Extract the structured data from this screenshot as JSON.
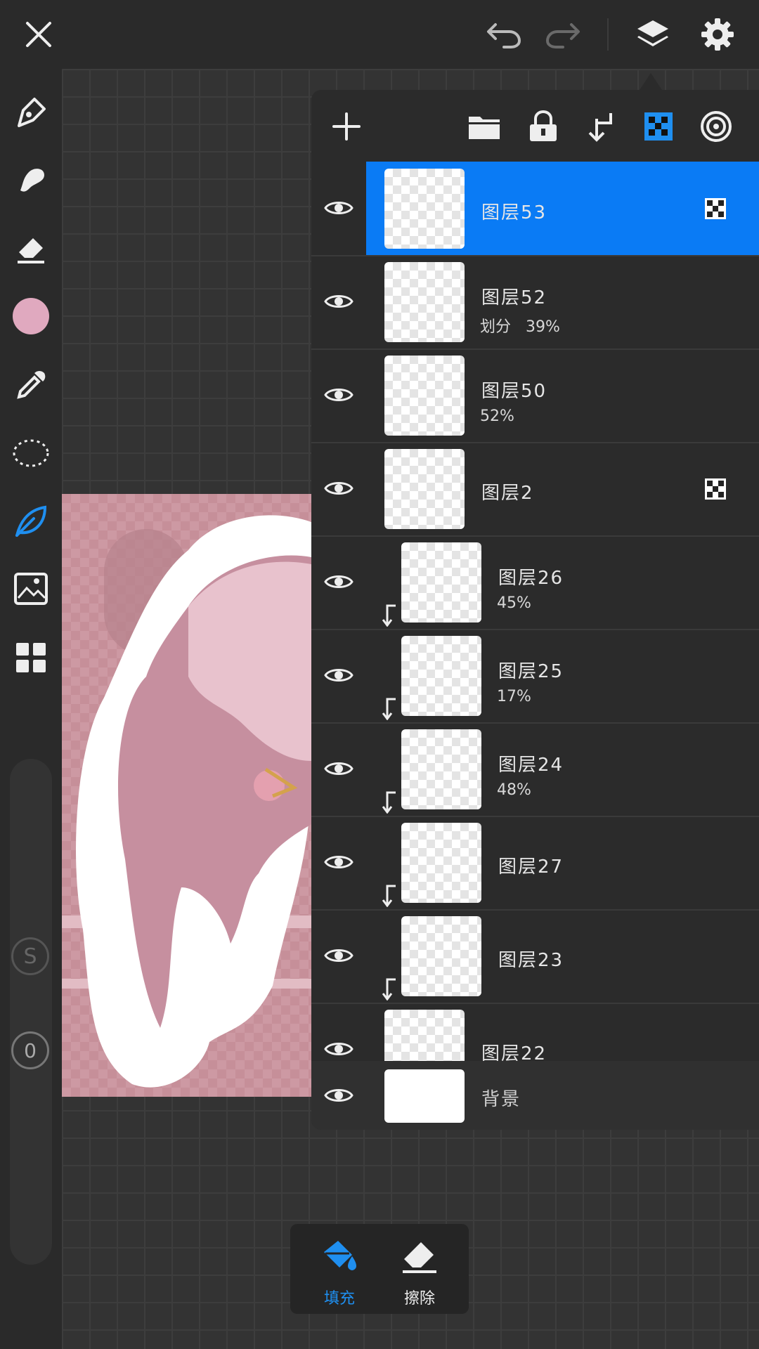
{
  "topbar": {
    "icons": [
      "close-icon",
      "undo-icon",
      "redo-icon",
      "layers-icon",
      "settings-icon"
    ]
  },
  "toolbar": {
    "tools": [
      "pen-icon",
      "smudge-icon",
      "eraser-icon",
      "color-swatch",
      "eyedropper-icon",
      "lasso-icon",
      "fill-leaf-icon",
      "image-import-icon",
      "grid-icon"
    ],
    "color": "#e0a9bf",
    "active_tool_color": "#1f8ff0",
    "stabilizer_label": "S",
    "opacity_value": "0"
  },
  "layers_panel": {
    "toolbar_icons": [
      "add-layer-icon",
      "folder-icon",
      "lock-icon",
      "clip-icon",
      "alpha-lock-icon",
      "target-icon"
    ],
    "layers": [
      {
        "name": "图层53",
        "sub": "",
        "selected": true,
        "clipped": false,
        "alpha_lock": true
      },
      {
        "name": "图层52",
        "sub": "划分   39%",
        "selected": false,
        "clipped": false,
        "alpha_lock": false
      },
      {
        "name": "图层50",
        "sub": "52%",
        "selected": false,
        "clipped": false,
        "alpha_lock": false
      },
      {
        "name": "图层2",
        "sub": "",
        "selected": false,
        "clipped": false,
        "alpha_lock": true
      },
      {
        "name": "图层26",
        "sub": "45%",
        "selected": false,
        "clipped": true,
        "alpha_lock": false
      },
      {
        "name": "图层25",
        "sub": "17%",
        "selected": false,
        "clipped": true,
        "alpha_lock": false
      },
      {
        "name": "图层24",
        "sub": "48%",
        "selected": false,
        "clipped": true,
        "alpha_lock": false
      },
      {
        "name": "图层27",
        "sub": "",
        "selected": false,
        "clipped": true,
        "alpha_lock": false
      },
      {
        "name": "图层23",
        "sub": "",
        "selected": false,
        "clipped": true,
        "alpha_lock": false
      },
      {
        "name": "图层22",
        "sub": "",
        "selected": false,
        "clipped": false,
        "alpha_lock": false
      }
    ],
    "background_layer": {
      "name": "背景"
    },
    "selected_color": "#0a7bf5"
  },
  "fill_bar": {
    "fill_label": "填充",
    "erase_label": "擦除",
    "active_color": "#1f8ff0"
  }
}
